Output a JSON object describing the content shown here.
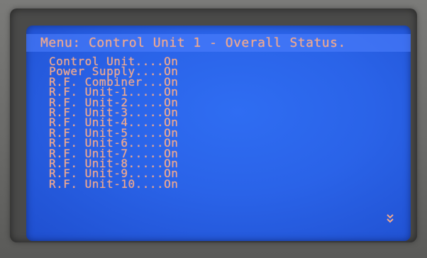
{
  "screen": {
    "title": "Menu: Control Unit 1 - Overall Status.",
    "items": [
      "Control Unit....On",
      "Power Supply....On",
      "R.F. Combiner...On",
      "R.F. Unit-1.....On",
      "R.F. Unit-2.....On",
      "R.F. Unit-3.....On",
      "R.F. Unit-4.....On",
      "R.F. Unit-5.....On",
      "R.F. Unit-6.....On",
      "R.F. Unit-7.....On",
      "R.F. Unit-8.....On",
      "R.F. Unit-9.....On",
      "R.F. Unit-10....On"
    ],
    "scroll_icon": "chevron-double-down-icon"
  },
  "colors": {
    "lcd_background": "#2a63e8",
    "lcd_text": "#f0a78d",
    "bezel": "#4a4a49"
  }
}
